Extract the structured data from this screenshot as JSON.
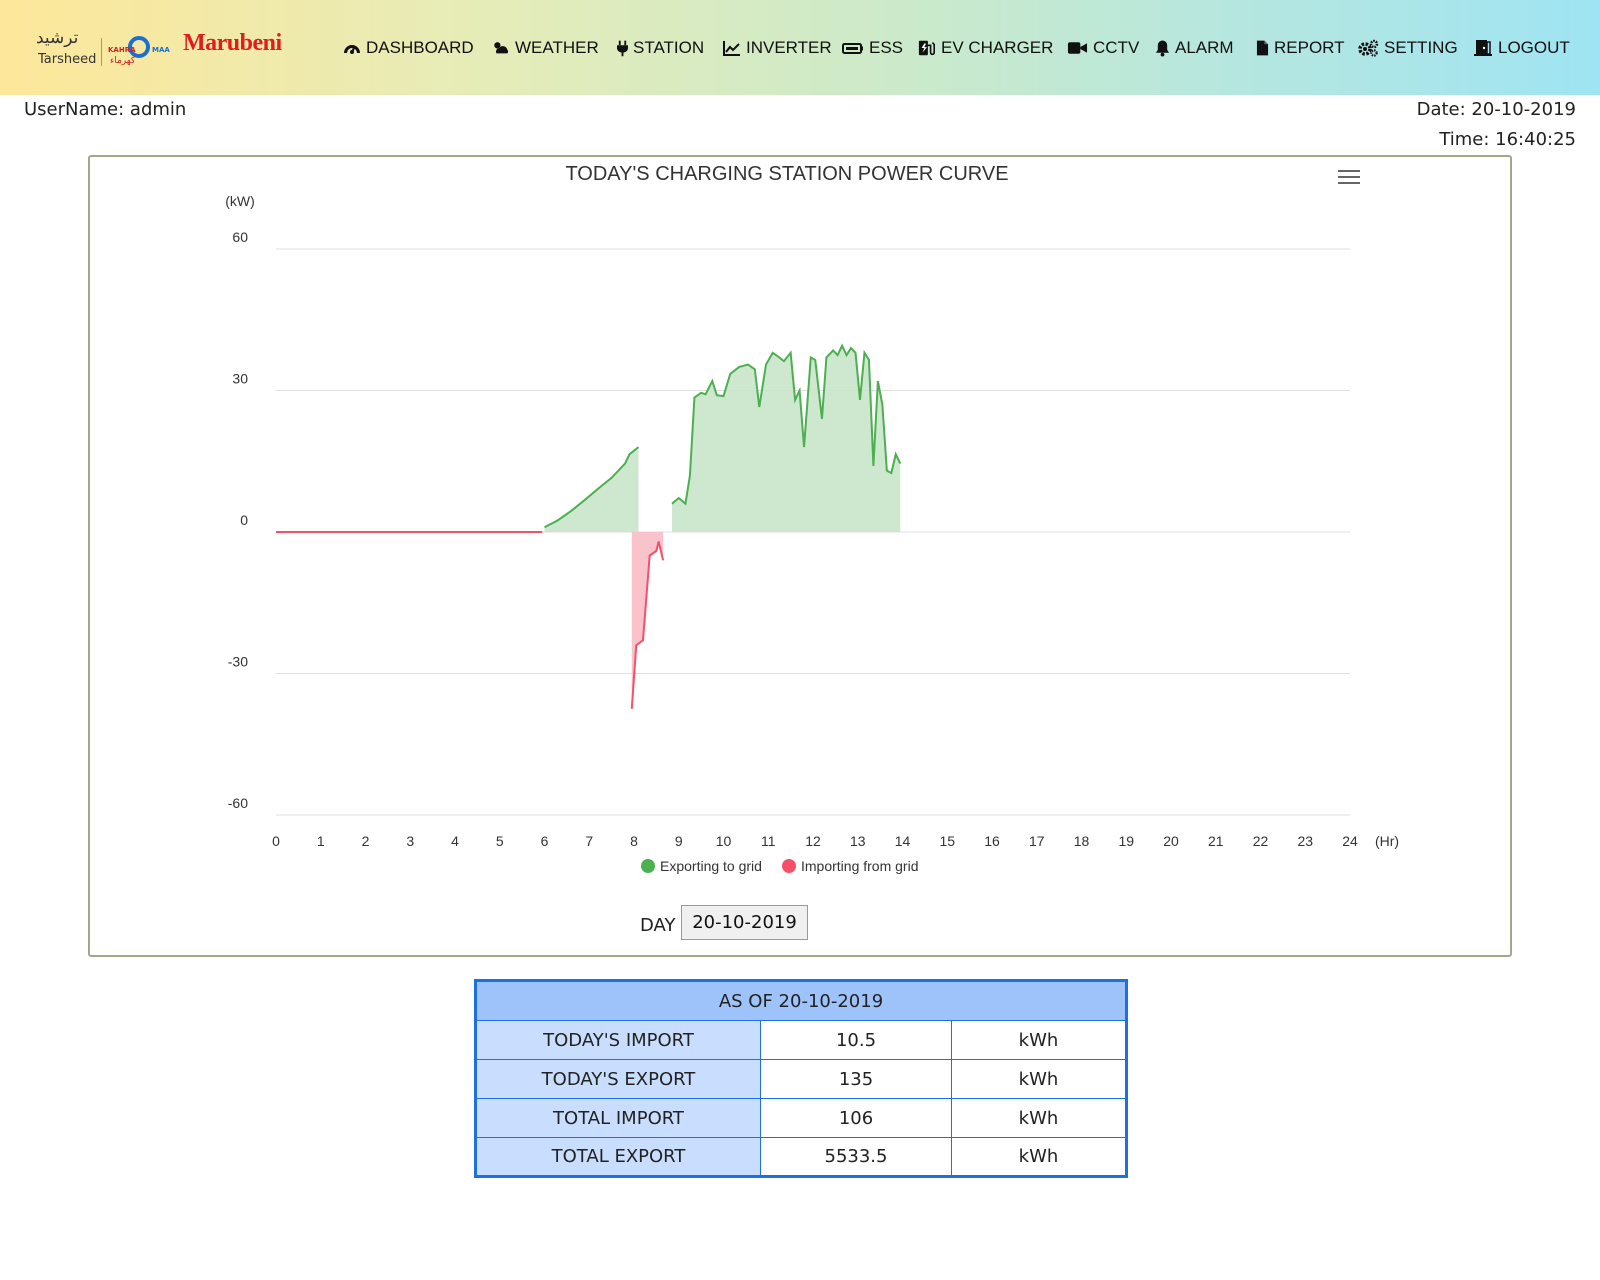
{
  "header": {
    "logos": {
      "tarsheed_ar": "ترشيد",
      "tarsheed_en": "Tarsheed",
      "kahramaa_left": "KAHRA",
      "kahramaa_right": "MAA",
      "kahramaa_ar": "كهرماء",
      "marubeni": "Marubeni"
    },
    "nav": [
      {
        "label": "DASHBOARD",
        "icon": "dashboard-icon"
      },
      {
        "label": "WEATHER",
        "icon": "weather-icon"
      },
      {
        "label": "STATION",
        "icon": "plug-icon"
      },
      {
        "label": "INVERTER",
        "icon": "line-chart-icon"
      },
      {
        "label": "ESS",
        "icon": "battery-icon"
      },
      {
        "label": "EV CHARGER",
        "icon": "ev-charger-icon"
      },
      {
        "label": "CCTV",
        "icon": "video-camera-icon"
      },
      {
        "label": "ALARM",
        "icon": "bell-icon"
      },
      {
        "label": "REPORT",
        "icon": "file-icon"
      },
      {
        "label": "SETTING",
        "icon": "gears-icon"
      },
      {
        "label": "LOGOUT",
        "icon": "logout-door-icon"
      }
    ]
  },
  "session": {
    "username": "UserName: admin",
    "date": "Date: 20-10-2019",
    "time": "Time: 16:40:25"
  },
  "chart_data": {
    "type": "area",
    "title": "TODAY'S CHARGING STATION POWER CURVE",
    "ylabel": "(kW)",
    "xlabel": "(Hr)",
    "ylim": [
      -60,
      60
    ],
    "xlim": [
      0,
      24
    ],
    "yticks": [
      60,
      30,
      0,
      -30,
      -60
    ],
    "xticks": [
      0,
      1,
      2,
      3,
      4,
      5,
      6,
      7,
      8,
      9,
      10,
      11,
      12,
      13,
      14,
      15,
      16,
      17,
      18,
      19,
      20,
      21,
      22,
      23,
      24
    ],
    "grid": true,
    "legend_position": "bottom",
    "series": [
      {
        "name": "Exporting to grid",
        "color": "#4caf50",
        "fill": "#c8e6c9",
        "segments": [
          [
            [
              6.0,
              1.0
            ],
            [
              6.3,
              2.5
            ],
            [
              6.6,
              4.5
            ],
            [
              6.9,
              6.8
            ],
            [
              7.2,
              9.2
            ],
            [
              7.5,
              11.5
            ],
            [
              7.8,
              14.5
            ],
            [
              7.9,
              16.5
            ],
            [
              8.1,
              18.0
            ]
          ],
          [
            [
              8.85,
              6.0
            ],
            [
              9.0,
              7.2
            ],
            [
              9.15,
              6.0
            ],
            [
              9.25,
              12.0
            ],
            [
              9.35,
              28.5
            ],
            [
              9.5,
              29.5
            ],
            [
              9.6,
              29.2
            ],
            [
              9.75,
              32.0
            ],
            [
              9.85,
              29.0
            ],
            [
              10.0,
              28.8
            ],
            [
              10.15,
              33.5
            ],
            [
              10.35,
              35.0
            ],
            [
              10.55,
              35.5
            ],
            [
              10.7,
              34.5
            ],
            [
              10.8,
              26.5
            ],
            [
              10.95,
              35.5
            ],
            [
              11.1,
              38.0
            ],
            [
              11.25,
              37.0
            ],
            [
              11.35,
              36.2
            ],
            [
              11.5,
              38.0
            ],
            [
              11.6,
              28.0
            ],
            [
              11.7,
              30.0
            ],
            [
              11.8,
              18.0
            ],
            [
              11.95,
              37.0
            ],
            [
              12.05,
              36.5
            ],
            [
              12.2,
              24.0
            ],
            [
              12.3,
              37.0
            ],
            [
              12.45,
              38.5
            ],
            [
              12.55,
              37.5
            ],
            [
              12.65,
              39.5
            ],
            [
              12.75,
              37.5
            ],
            [
              12.85,
              39.0
            ],
            [
              12.95,
              38.0
            ],
            [
              13.05,
              28.0
            ],
            [
              13.15,
              38.0
            ],
            [
              13.25,
              36.5
            ],
            [
              13.35,
              14.0
            ],
            [
              13.45,
              32.0
            ],
            [
              13.55,
              27.0
            ],
            [
              13.65,
              13.0
            ],
            [
              13.75,
              12.5
            ],
            [
              13.85,
              16.5
            ],
            [
              13.95,
              14.5
            ]
          ]
        ]
      },
      {
        "name": "Importing from grid",
        "color": "#f4506a",
        "fill": "#f8bcc6",
        "segments": [
          [
            [
              0.0,
              0.0
            ],
            [
              5.95,
              0.0
            ]
          ],
          [
            [
              7.95,
              -37.5
            ],
            [
              8.05,
              -24.0
            ],
            [
              8.2,
              -23.0
            ],
            [
              8.35,
              -5.0
            ],
            [
              8.5,
              -4.0
            ],
            [
              8.55,
              -2.0
            ],
            [
              8.65,
              -6.0
            ]
          ]
        ]
      }
    ]
  },
  "day_picker": {
    "label": "DAY",
    "value": "20-10-2019"
  },
  "summary": {
    "header": "AS OF 20-10-2019",
    "rows": [
      {
        "label": "TODAY'S IMPORT",
        "value": "10.5",
        "unit": "kWh"
      },
      {
        "label": "TODAY'S EXPORT",
        "value": "135",
        "unit": "kWh"
      },
      {
        "label": "TOTAL IMPORT",
        "value": "106",
        "unit": "kWh"
      },
      {
        "label": "TOTAL EXPORT",
        "value": "5533.5",
        "unit": "kWh"
      }
    ]
  }
}
